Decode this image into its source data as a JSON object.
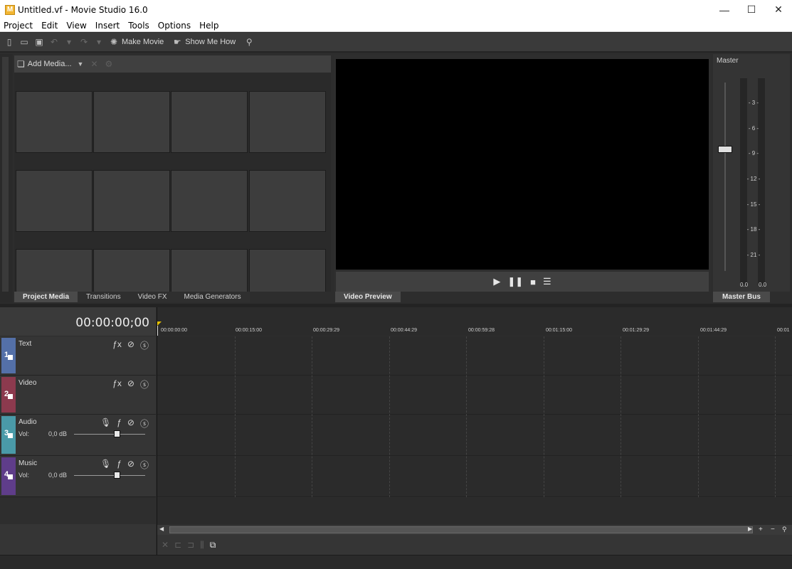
{
  "window": {
    "title": "Untitled.vf - Movie Studio 16.0",
    "app_icon_letter": "M",
    "minimize_glyph": "—",
    "maximize_glyph": "☐",
    "close_glyph": "✕"
  },
  "menu": [
    "Project",
    "Edit",
    "View",
    "Insert",
    "Tools",
    "Options",
    "Help"
  ],
  "toolbar": {
    "make_movie": "Make Movie",
    "show_me_how": "Show Me How"
  },
  "media_panel": {
    "add_media": "Add Media...",
    "tabs": [
      {
        "label": "Project Media",
        "active": true
      },
      {
        "label": "Transitions",
        "active": false
      },
      {
        "label": "Video FX",
        "active": false
      },
      {
        "label": "Media Generators",
        "active": false
      }
    ]
  },
  "preview": {
    "tab_label": "Video Preview"
  },
  "master": {
    "title": "Master",
    "scale": [
      "- 3 -",
      "- 6 -",
      "- 9 -",
      "- 12 -",
      "- 15 -",
      "- 18 -",
      "- 21 -"
    ],
    "left_value": "0.0",
    "right_value": "0.0",
    "tab_label": "Master Bus"
  },
  "timeline": {
    "timecode": "00:00:00;00",
    "ruler_labels": [
      "00:00:00:00",
      "00:00:15:00",
      "00:00:29:29",
      "00:00:44:29",
      "00:00:59:28",
      "00:01:15:00",
      "00:01:29:29",
      "00:01:44:29",
      "00:01"
    ],
    "tracks": [
      {
        "num": "1",
        "name": "Text",
        "color": "#5470a8",
        "type": "video"
      },
      {
        "num": "2",
        "name": "Video",
        "color": "#8c3a4e",
        "type": "video"
      },
      {
        "num": "3",
        "name": "Audio",
        "color": "#4a9aa8",
        "type": "audio",
        "vol_label": "Vol:",
        "vol_value": "0,0 dB"
      },
      {
        "num": "4",
        "name": "Music",
        "color": "#5f3d8a",
        "type": "audio",
        "vol_label": "Vol:",
        "vol_value": "0,0 dB"
      }
    ]
  }
}
